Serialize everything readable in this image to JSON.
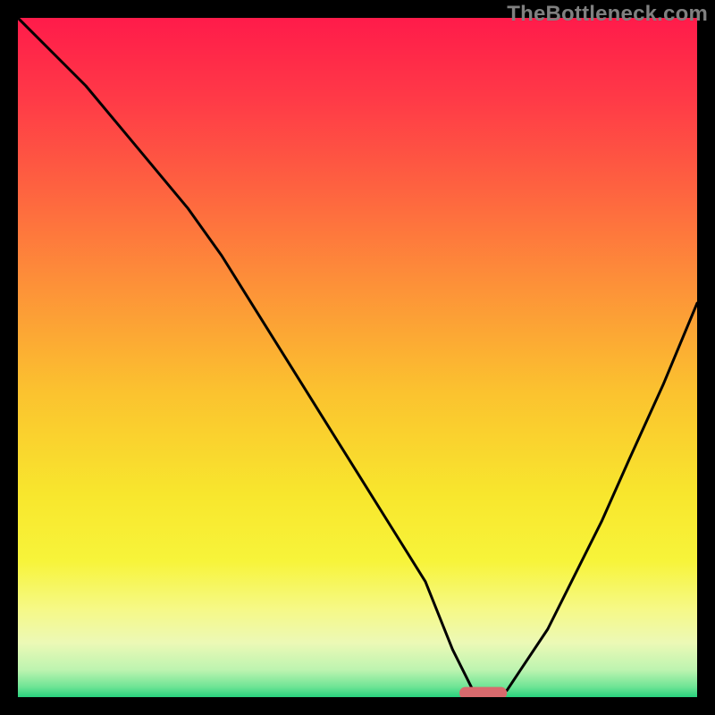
{
  "watermark": "TheBottleneck.com",
  "colors": {
    "gradient_stops": [
      {
        "offset": 0.0,
        "color": "#ff1b4a"
      },
      {
        "offset": 0.12,
        "color": "#ff3a47"
      },
      {
        "offset": 0.25,
        "color": "#fe6240"
      },
      {
        "offset": 0.4,
        "color": "#fd9338"
      },
      {
        "offset": 0.55,
        "color": "#fbc22f"
      },
      {
        "offset": 0.7,
        "color": "#f8e62d"
      },
      {
        "offset": 0.8,
        "color": "#f7f43a"
      },
      {
        "offset": 0.87,
        "color": "#f6f986"
      },
      {
        "offset": 0.92,
        "color": "#ecf9b6"
      },
      {
        "offset": 0.96,
        "color": "#bdf4b0"
      },
      {
        "offset": 0.985,
        "color": "#6ee495"
      },
      {
        "offset": 1.0,
        "color": "#28d17d"
      }
    ],
    "frame": "#000000",
    "curve": "#000000",
    "marker": "#d86a6d"
  },
  "chart_data": {
    "type": "line",
    "title": "",
    "xlabel": "",
    "ylabel": "",
    "xlim": [
      0,
      100
    ],
    "ylim": [
      0,
      100
    ],
    "grid": false,
    "legend_position": "none",
    "note": "Axes are unitless; values are visually estimated from the plotted curve (percentage of plot extent).",
    "series": [
      {
        "name": "bottleneck-curve",
        "x": [
          0,
          5,
          10,
          15,
          20,
          25,
          30,
          35,
          40,
          45,
          50,
          55,
          60,
          62,
          64,
          66,
          67,
          68,
          70,
          72,
          74,
          78,
          82,
          86,
          90,
          95,
          100
        ],
        "y": [
          100,
          95,
          90,
          84,
          78,
          72,
          65,
          57,
          49,
          41,
          33,
          25,
          17,
          12,
          7,
          3,
          1,
          0,
          0,
          1,
          4,
          10,
          18,
          26,
          35,
          46,
          58
        ]
      }
    ],
    "annotations": [
      {
        "name": "min-marker",
        "shape": "capsule",
        "x_center": 68.5,
        "y_center": 0.6,
        "width": 7.0,
        "height": 1.8,
        "color": "#d86a6d"
      }
    ]
  }
}
